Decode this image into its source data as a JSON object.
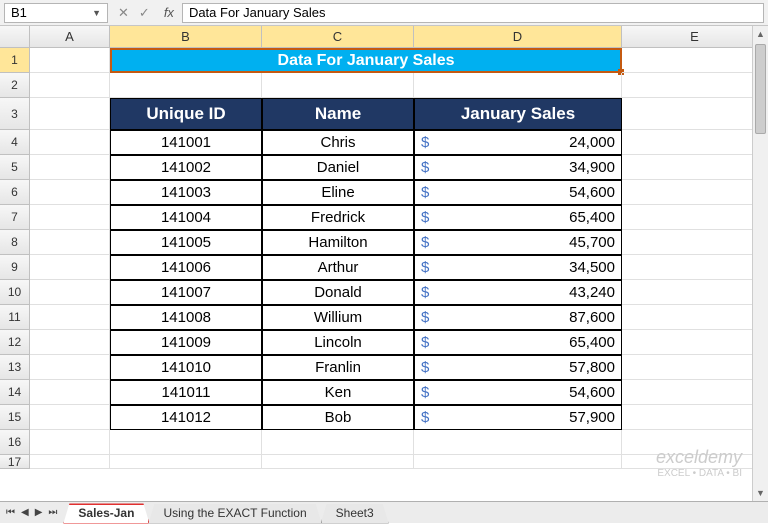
{
  "nameBox": "B1",
  "formula": "Data For January Sales",
  "columns": {
    "a": "A",
    "b": "B",
    "c": "C",
    "d": "D",
    "e": "E"
  },
  "rownums": [
    "1",
    "2",
    "3",
    "4",
    "5",
    "6",
    "7",
    "8",
    "9",
    "10",
    "11",
    "12",
    "13",
    "14",
    "15",
    "16",
    "17"
  ],
  "title": "Data For January Sales",
  "headers": {
    "id": "Unique ID",
    "name": "Name",
    "sales": "January Sales"
  },
  "currency": "$",
  "rows": [
    {
      "id": "141001",
      "name": "Chris",
      "sales": "24,000"
    },
    {
      "id": "141002",
      "name": "Daniel",
      "sales": "34,900"
    },
    {
      "id": "141003",
      "name": "Eline",
      "sales": "54,600"
    },
    {
      "id": "141004",
      "name": "Fredrick",
      "sales": "65,400"
    },
    {
      "id": "141005",
      "name": "Hamilton",
      "sales": "45,700"
    },
    {
      "id": "141006",
      "name": "Arthur",
      "sales": "34,500"
    },
    {
      "id": "141007",
      "name": "Donald",
      "sales": "43,240"
    },
    {
      "id": "141008",
      "name": "Willium",
      "sales": "87,600"
    },
    {
      "id": "141009",
      "name": "Lincoln",
      "sales": "65,400"
    },
    {
      "id": "141010",
      "name": "Franlin",
      "sales": "57,800"
    },
    {
      "id": "141011",
      "name": "Ken",
      "sales": "54,600"
    },
    {
      "id": "141012",
      "name": "Bob",
      "sales": "57,900"
    }
  ],
  "tabs": {
    "t1": "Sales-Jan",
    "t2": "Using the EXACT Function",
    "t3": "Sheet3"
  },
  "watermark": {
    "brand": "exceldemy",
    "tag": "EXCEL • DATA • BI"
  }
}
